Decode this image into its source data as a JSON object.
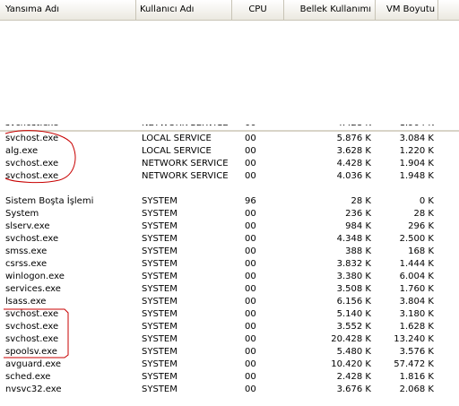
{
  "columns": {
    "name": "Yansıma Adı",
    "user": "Kullanıcı Adı",
    "cpu": "CPU",
    "memory": "Bellek Kullanımı",
    "vm": "VM Boyutu"
  },
  "top_rows": [
    {
      "name": "svchost.exe",
      "user": "LOCAL SERVICE",
      "cpu": "00",
      "mem": "5.876 K",
      "vm": "3.084 K"
    },
    {
      "name": "alg.exe",
      "user": "LOCAL SERVICE",
      "cpu": "00",
      "mem": "3.628 K",
      "vm": "1.220 K"
    },
    {
      "name": "svchost.exe",
      "user": "NETWORK SERVICE",
      "cpu": "00",
      "mem": "4.428 K",
      "vm": "1.904 K"
    },
    {
      "name": "svchost.exe",
      "user": "NETWORK SERVICE",
      "cpu": "00",
      "mem": "4.036 K",
      "vm": "1.948 K"
    }
  ],
  "bottom_rows": [
    {
      "name": "Sistem Boşta İşlemi",
      "user": "SYSTEM",
      "cpu": "96",
      "mem": "28 K",
      "vm": "0 K"
    },
    {
      "name": "System",
      "user": "SYSTEM",
      "cpu": "00",
      "mem": "236 K",
      "vm": "28 K"
    },
    {
      "name": "slserv.exe",
      "user": "SYSTEM",
      "cpu": "00",
      "mem": "984 K",
      "vm": "296 K"
    },
    {
      "name": "svchost.exe",
      "user": "SYSTEM",
      "cpu": "00",
      "mem": "4.348 K",
      "vm": "2.500 K"
    },
    {
      "name": "smss.exe",
      "user": "SYSTEM",
      "cpu": "00",
      "mem": "388 K",
      "vm": "168 K"
    },
    {
      "name": "csrss.exe",
      "user": "SYSTEM",
      "cpu": "00",
      "mem": "3.832 K",
      "vm": "1.444 K"
    },
    {
      "name": "winlogon.exe",
      "user": "SYSTEM",
      "cpu": "00",
      "mem": "3.380 K",
      "vm": "6.004 K"
    },
    {
      "name": "services.exe",
      "user": "SYSTEM",
      "cpu": "00",
      "mem": "3.508 K",
      "vm": "1.760 K"
    },
    {
      "name": "lsass.exe",
      "user": "SYSTEM",
      "cpu": "00",
      "mem": "6.156 K",
      "vm": "3.804 K"
    },
    {
      "name": "svchost.exe",
      "user": "SYSTEM",
      "cpu": "00",
      "mem": "5.140 K",
      "vm": "3.180 K"
    },
    {
      "name": "svchost.exe",
      "user": "SYSTEM",
      "cpu": "00",
      "mem": "3.552 K",
      "vm": "1.628 K"
    },
    {
      "name": "svchost.exe",
      "user": "SYSTEM",
      "cpu": "00",
      "mem": "20.428 K",
      "vm": "13.240 K"
    },
    {
      "name": "spoolsv.exe",
      "user": "SYSTEM",
      "cpu": "00",
      "mem": "5.480 K",
      "vm": "3.576 K"
    },
    {
      "name": "avguard.exe",
      "user": "SYSTEM",
      "cpu": "00",
      "mem": "10.420 K",
      "vm": "57.472 K"
    },
    {
      "name": "sched.exe",
      "user": "SYSTEM",
      "cpu": "00",
      "mem": "2.428 K",
      "vm": "1.816 K"
    },
    {
      "name": "nvsvc32.exe",
      "user": "SYSTEM",
      "cpu": "00",
      "mem": "3.676 K",
      "vm": "2.068 K"
    }
  ],
  "colors": {
    "annotation": "#c80000",
    "header_bg": "#ebe9e0",
    "grid_line": "#c8c4b6"
  }
}
